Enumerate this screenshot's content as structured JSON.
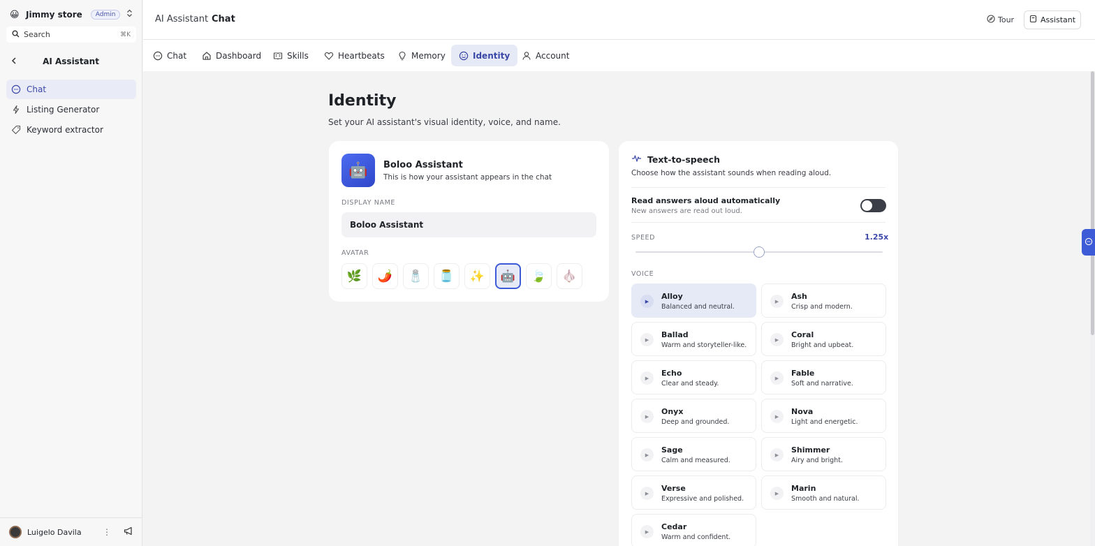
{
  "sidebar": {
    "store_emoji": "😀",
    "store_name": "Jimmy store",
    "role_badge": "Admin",
    "search_label": "Search",
    "search_shortcut": "⌘K",
    "section_title": "AI Assistant",
    "items": [
      {
        "label": "Chat",
        "icon": "chat-bubble-icon",
        "active": true
      },
      {
        "label": "Listing Generator",
        "icon": "lightning-icon",
        "active": false
      },
      {
        "label": "Keyword extractor",
        "icon": "tag-icon",
        "active": false
      }
    ],
    "user_name": "Luigelo Davila"
  },
  "header": {
    "breadcrumb_parent": "AI Assistant",
    "breadcrumb_current": "Chat",
    "tour_label": "Tour",
    "assistant_label": "Assistant"
  },
  "tabs": [
    {
      "label": "Chat",
      "icon": "chat-bubble-icon",
      "active": false
    },
    {
      "label": "Dashboard",
      "icon": "home-icon",
      "active": false
    },
    {
      "label": "Skills",
      "icon": "book-icon",
      "active": false
    },
    {
      "label": "Heartbeats",
      "icon": "heart-icon",
      "active": false
    },
    {
      "label": "Memory",
      "icon": "lightbulb-icon",
      "active": false
    },
    {
      "label": "Identity",
      "icon": "smile-icon",
      "active": true
    },
    {
      "label": "Account",
      "icon": "user-icon",
      "active": false
    }
  ],
  "page": {
    "title": "Identity",
    "subtitle": "Set your AI assistant's visual identity, voice, and name."
  },
  "identity": {
    "avatar_emoji": "🤖",
    "name": "Boloo Assistant",
    "description": "This is how your assistant appears in the chat",
    "display_name_label": "DISPLAY NAME",
    "display_name_value": "Boloo Assistant",
    "avatar_label": "AVATAR",
    "avatar_options": [
      "🌿",
      "🌶️",
      "🧂",
      "🫙",
      "✨",
      "🤖",
      "🍃",
      "🧄"
    ],
    "selected_avatar_index": 5
  },
  "tts": {
    "title": "Text-to-speech",
    "subtitle": "Choose how the assistant sounds when reading aloud.",
    "auto_read_title": "Read answers aloud automatically",
    "auto_read_subtitle": "New answers are read out loud.",
    "auto_read_enabled": false,
    "speed_label": "SPEED",
    "speed_value": "1.25x",
    "speed_min": 0.5,
    "speed_max": 2.0,
    "speed_current": 1.25,
    "voice_label": "VOICE",
    "voices": [
      {
        "name": "Alloy",
        "desc": "Balanced and neutral.",
        "selected": true
      },
      {
        "name": "Ash",
        "desc": "Crisp and modern.",
        "selected": false
      },
      {
        "name": "Ballad",
        "desc": "Warm and storyteller-like.",
        "selected": false
      },
      {
        "name": "Coral",
        "desc": "Bright and upbeat.",
        "selected": false
      },
      {
        "name": "Echo",
        "desc": "Clear and steady.",
        "selected": false
      },
      {
        "name": "Fable",
        "desc": "Soft and narrative.",
        "selected": false
      },
      {
        "name": "Onyx",
        "desc": "Deep and grounded.",
        "selected": false
      },
      {
        "name": "Nova",
        "desc": "Light and energetic.",
        "selected": false
      },
      {
        "name": "Sage",
        "desc": "Calm and measured.",
        "selected": false
      },
      {
        "name": "Shimmer",
        "desc": "Airy and bright.",
        "selected": false
      },
      {
        "name": "Verse",
        "desc": "Expressive and polished.",
        "selected": false
      },
      {
        "name": "Marin",
        "desc": "Smooth and natural.",
        "selected": false
      },
      {
        "name": "Cedar",
        "desc": "Warm and confident.",
        "selected": false
      }
    ]
  },
  "colors": {
    "accent": "#3d5bd6",
    "accent_text": "#3a48a8",
    "active_bg": "#e6e9f6"
  }
}
